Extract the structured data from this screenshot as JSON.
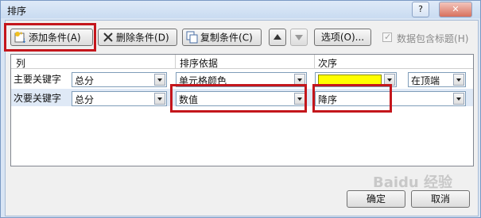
{
  "window": {
    "title": "排序",
    "help_label": "?",
    "close_label": "✕"
  },
  "toolbar": {
    "add_label": "添加条件",
    "add_hotkey": "(A)",
    "delete_label": "删除条件",
    "delete_hotkey": "(D)",
    "copy_label": "复制条件",
    "copy_hotkey": "(C)",
    "move_up_icon": "triangle-up",
    "move_down_icon": "triangle-down",
    "options_label": "选项(O)...",
    "header_checkbox_label": "数据包含标题",
    "header_checkbox_hotkey": "(H)",
    "header_checkbox_checked": true
  },
  "grid": {
    "headers": {
      "column": "列",
      "sort_on": "排序依据",
      "order": "次序"
    },
    "rows": [
      {
        "label": "主要关键字",
        "column": "总分",
        "sort_on": "单元格颜色",
        "order_color": "#FFFF00",
        "position": "在顶端"
      },
      {
        "label": "次要关键字",
        "column": "总分",
        "sort_on": "数值",
        "order": "降序"
      }
    ]
  },
  "footer": {
    "ok_label": "确定",
    "cancel_label": "取消"
  },
  "watermark": "Baidu 经验",
  "colors": {
    "highlight_box": "#C4161C",
    "selected_row": "#DFE9F6"
  }
}
